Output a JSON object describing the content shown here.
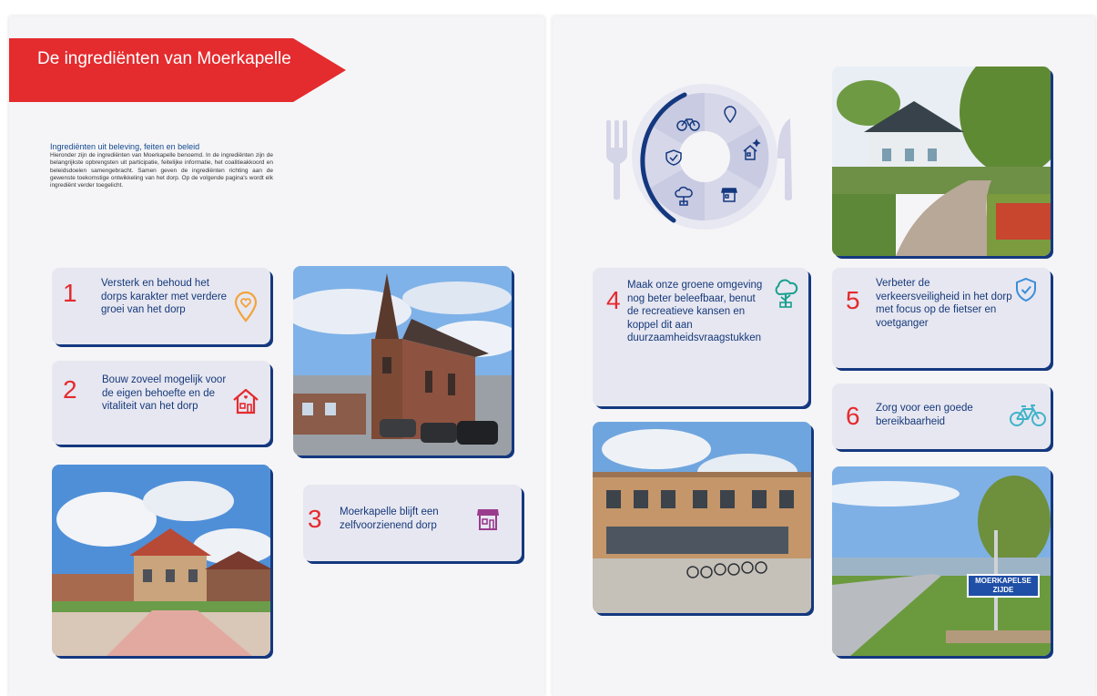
{
  "banner": {
    "title": "De ingrediënten van Moerkapelle"
  },
  "intro": {
    "heading": "Ingrediënten uit beleving, feiten en beleid",
    "body": "Hieronder zijn de ingrediënten van Moerkapelle benoemd. In de ingrediënten zijn de belangrijkste opbrengsten uit participatie, feitelijke informatie, het coalitieakkoord en beleidsdoelen samengebracht. Samen geven de ingrediënten richting aan de gewenste toekomstige ontwikkeling van het dorp. Op de volgende pagina's wordt elk ingrediënt verder toegelicht."
  },
  "ingredients": [
    {
      "number": "1",
      "text": "Versterk en behoud het dorps karakter met verdere groei van het dorp",
      "icon": "location-heart-icon",
      "icon_color": "#f2a33a"
    },
    {
      "number": "2",
      "text": "Bouw zoveel mogelijk voor de eigen behoefte en de vitaliteit van het dorp",
      "icon": "house-heart-icon",
      "icon_color": "#e42b2e"
    },
    {
      "number": "3",
      "text": "Moerkapelle blijft een zelfvoorzienend dorp",
      "icon": "shop-icon",
      "icon_color": "#9a3c8e"
    },
    {
      "number": "4",
      "text": "Maak onze groene omgeving nog beter beleefbaar, benut de recreatieve kansen en koppel dit aan duurzaamheidsvraagstukken",
      "icon": "tree-icon",
      "icon_color": "#18a08d"
    },
    {
      "number": "5",
      "text": "Verbeter de verkeersveiligheid in het dorp met focus op de fietser en voetganger",
      "icon": "shield-check-icon",
      "icon_color": "#3a8ed8"
    },
    {
      "number": "6",
      "text": "Zorg voor een goede bereikbaarheid",
      "icon": "bicycle-icon",
      "icon_color": "#3fb3c9"
    }
  ],
  "photos": {
    "street_sign": "MOERKAPELSE ZIJDE"
  },
  "colors": {
    "accent_red": "#e42b2e",
    "navy": "#14387f",
    "card_bg": "#e7e7f1",
    "page_bg": "#f5f5f7"
  }
}
